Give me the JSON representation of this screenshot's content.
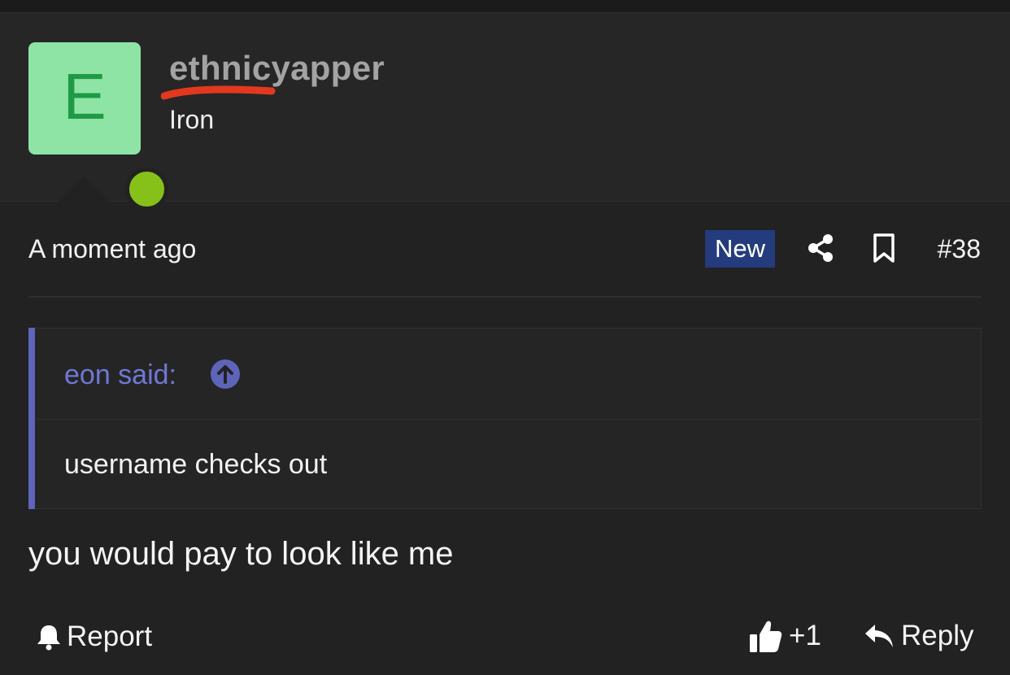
{
  "user": {
    "avatar_letter": "E",
    "username": "ethnicyapper",
    "title": "Iron",
    "online_status_color": "#86c119"
  },
  "post": {
    "time": "A moment ago",
    "badge": "New",
    "number": "#38",
    "quote": {
      "author_label": "eon said:",
      "text": "username checks out"
    },
    "body": "you would pay to look like me"
  },
  "actions": {
    "report_label": "Report",
    "like_count": "+1",
    "reply_label": "Reply"
  },
  "icons": [
    "share-icon",
    "bookmark-icon",
    "arrow-up-circle-icon",
    "bell-icon",
    "thumbs-up-icon",
    "reply-arrow-icon"
  ],
  "colors": {
    "background": "#222223",
    "accent_quote": "#5d64b9",
    "badge": "#243c7d",
    "avatar_bg": "#8ee4a4",
    "redaction_scribble": "#e2391e"
  }
}
